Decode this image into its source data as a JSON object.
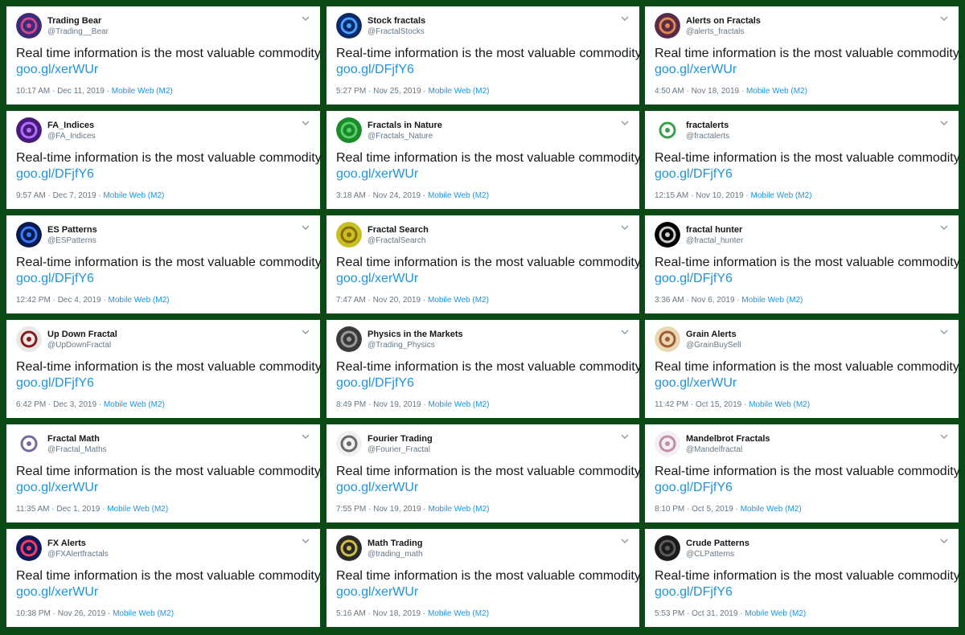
{
  "tweets": [
    {
      "name": "Trading Bear",
      "handle": "@Trading__Bear",
      "text": "Real time information is the most valuable commodity.",
      "link": "goo.gl/xerWUr",
      "time": "10:17 AM · Dec 11, 2019",
      "source": "Mobile Web (M2)",
      "avatar_color": "#3a2a7a",
      "avatar_accent": "#d04a8a"
    },
    {
      "name": "Stock fractals",
      "handle": "@FractalStocks",
      "text": "Real-time information is the most valuable commodity",
      "link": "goo.gl/DFjfY6",
      "time": "5:27 PM · Nov 25, 2019",
      "source": "Mobile Web (M2)",
      "avatar_color": "#0c2a6a",
      "avatar_accent": "#4aa0ff"
    },
    {
      "name": "Alerts on Fractals",
      "handle": "@alerts_fractals",
      "text": "Real time information is the most valuable commodity.",
      "link": "goo.gl/xerWUr",
      "time": "4:50 AM · Nov 18, 2019",
      "source": "Mobile Web (M2)",
      "avatar_color": "#5a2a4a",
      "avatar_accent": "#e08a4a"
    },
    {
      "name": "FA_Indices",
      "handle": "@FA_Indices",
      "text": "Real-time information is the most valuable commodity",
      "link": "goo.gl/DFjfY6",
      "time": "9:57 AM · Dec 7, 2019",
      "source": "Mobile Web (M2)",
      "avatar_color": "#4a1a7a",
      "avatar_accent": "#b070ff"
    },
    {
      "name": "Fractals in Nature",
      "handle": "@Fractals_Nature",
      "text": "Real time information is the most valuable commodity.",
      "link": "goo.gl/xerWUr",
      "time": "3:18 AM · Nov 24, 2019",
      "source": "Mobile Web (M2)",
      "avatar_color": "#1a8a2a",
      "avatar_accent": "#5ad06a"
    },
    {
      "name": "fractalerts",
      "handle": "@fractalerts",
      "text": "Real-time information is the most valuable commodity",
      "link": "goo.gl/DFjfY6",
      "time": "12:15 AM · Nov 10, 2019",
      "source": "Mobile Web (M2)",
      "avatar_color": "#ffffff",
      "avatar_accent": "#3aa04a"
    },
    {
      "name": "ES Patterns",
      "handle": "@ESPatterns",
      "text": "Real-time information is the most valuable commodity",
      "link": "goo.gl/DFjfY6",
      "time": "12:42 PM · Dec 4, 2019",
      "source": "Mobile Web (M2)",
      "avatar_color": "#0a1a4a",
      "avatar_accent": "#3a7aff"
    },
    {
      "name": "Fractal Search",
      "handle": "@FractalSearch",
      "text": "Real time information is the most valuable commodity.",
      "link": "goo.gl/xerWUr",
      "time": "7:47 AM · Nov 20, 2019",
      "source": "Mobile Web (M2)",
      "avatar_color": "#c8c020",
      "avatar_accent": "#8a6a10"
    },
    {
      "name": "fractal hunter",
      "handle": "@fractal_hunter",
      "text": "Real-time information is the most valuable commodity",
      "link": "goo.gl/DFjfY6",
      "time": "3:36 AM · Nov 6, 2019",
      "source": "Mobile Web (M2)",
      "avatar_color": "#000000",
      "avatar_accent": "#cccccc"
    },
    {
      "name": "Up Down Fractal",
      "handle": "@UpDownFractal",
      "text": "Real-time information is the most valuable commodity",
      "link": "goo.gl/DFjfY6",
      "time": "6:42 PM · Dec 3, 2019",
      "source": "Mobile Web (M2)",
      "avatar_color": "#e8e8e8",
      "avatar_accent": "#8a1a1a"
    },
    {
      "name": "Physics in the Markets",
      "handle": "@Trading_Physics",
      "text": "Real-time information is the most valuable commodity",
      "link": "goo.gl/DFjfY6",
      "time": "8:49 PM · Nov 19, 2019",
      "source": "Mobile Web (M2)",
      "avatar_color": "#3a3a3a",
      "avatar_accent": "#9a9a9a"
    },
    {
      "name": "Grain Alerts",
      "handle": "@GrainBuySell",
      "text": "Real time information is the most valuable commodity.",
      "link": "goo.gl/xerWUr",
      "time": "11:42 PM · Oct 15, 2019",
      "source": "Mobile Web (M2)",
      "avatar_color": "#e8d8b0",
      "avatar_accent": "#a05a3a"
    },
    {
      "name": "Fractal Math",
      "handle": "@Fractal_Maths",
      "text": "Real time information is the most valuable commodity.",
      "link": "goo.gl/xerWUr",
      "time": "11:35 AM · Dec 1, 2019",
      "source": "Mobile Web (M2)",
      "avatar_color": "#ffffff",
      "avatar_accent": "#7a6aa0"
    },
    {
      "name": "Fourier Trading",
      "handle": "@Fourier_Fractal",
      "text": "Real time information is the most valuable commodity.",
      "link": "goo.gl/xerWUr",
      "time": "7:55 PM · Nov 19, 2019",
      "source": "Mobile Web (M2)",
      "avatar_color": "#f0f0f0",
      "avatar_accent": "#6a6a6a"
    },
    {
      "name": "Mandelbrot Fractals",
      "handle": "@Mandelfractal",
      "text": "Real-time information is the most valuable commodity",
      "link": "goo.gl/DFjfY6",
      "time": "8:10 PM · Oct 5, 2019",
      "source": "Mobile Web (M2)",
      "avatar_color": "#f4eef8",
      "avatar_accent": "#c090a0"
    },
    {
      "name": "FX Alerts",
      "handle": "@FXAlertfractals",
      "text": "Real time information is the most valuable commodity.",
      "link": "goo.gl/xerWUr",
      "time": "10:38 PM · Nov 26, 2019",
      "source": "Mobile Web (M2)",
      "avatar_color": "#0a1a5a",
      "avatar_accent": "#ff3a5a"
    },
    {
      "name": "Math Trading",
      "handle": "@trading_math",
      "text": "Real time information is the most valuable commodity.",
      "link": "goo.gl/xerWUr",
      "time": "5:16 AM · Nov 18, 2019",
      "source": "Mobile Web (M2)",
      "avatar_color": "#2a2a2a",
      "avatar_accent": "#d0c040"
    },
    {
      "name": "Crude Patterns",
      "handle": "@CLPatterns",
      "text": "Real-time information is the most valuable commodity",
      "link": "goo.gl/DFjfY6",
      "time": "5:53 PM · Oct 31, 2019",
      "source": "Mobile Web (M2)",
      "avatar_color": "#1a1a1a",
      "avatar_accent": "#5a5a5a"
    }
  ]
}
